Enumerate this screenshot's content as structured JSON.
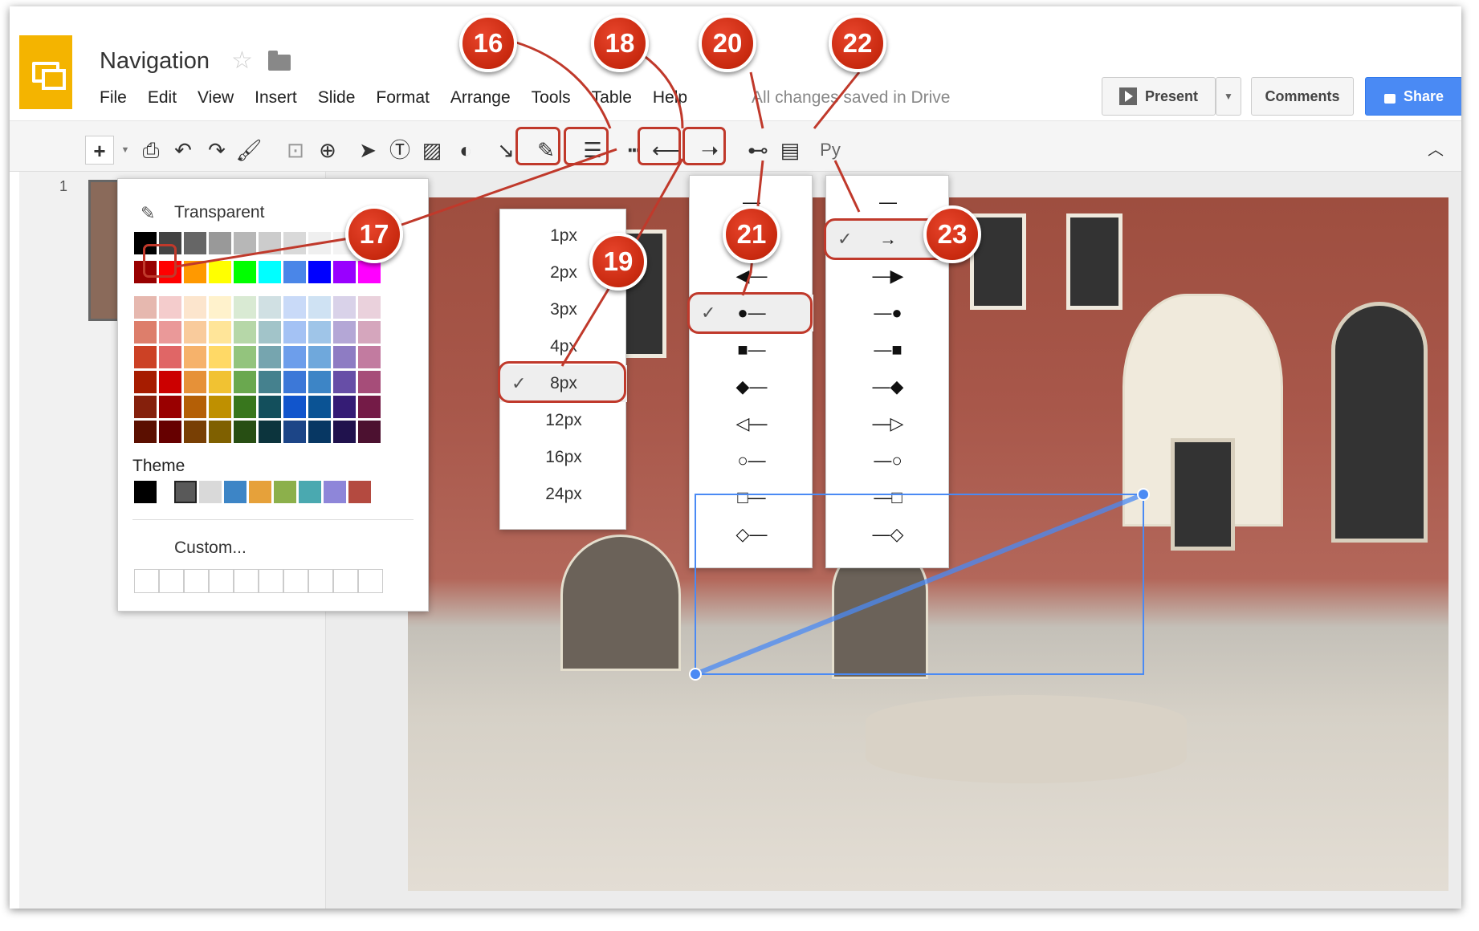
{
  "app": {
    "doc_title": "Navigation",
    "status": "All changes saved in Drive",
    "menu": [
      "File",
      "Edit",
      "View",
      "Insert",
      "Slide",
      "Format",
      "Arrange",
      "Tools",
      "Table",
      "Help"
    ],
    "present_label": "Present",
    "comments_label": "Comments",
    "share_label": "Share",
    "toolbar_py": "Py"
  },
  "filmstrip": {
    "slide_number": "1"
  },
  "color_panel": {
    "transparent_label": "Transparent",
    "theme_label": "Theme",
    "custom_label": "Custom...",
    "gray_row": [
      "#000000",
      "#434343",
      "#666666",
      "#999999",
      "#b7b7b7",
      "#cccccc",
      "#d9d9d9",
      "#efefef",
      "#f3f3f3",
      "#ffffff"
    ],
    "bright_row": [
      "#980000",
      "#ff0000",
      "#ff9900",
      "#ffff00",
      "#00ff00",
      "#00ffff",
      "#4a86e8",
      "#0000ff",
      "#9900ff",
      "#ff00ff"
    ],
    "shade_rows": [
      [
        "#e6b8af",
        "#f4cccc",
        "#fce5cd",
        "#fff2cc",
        "#d9ead3",
        "#d0e0e3",
        "#c9daf8",
        "#cfe2f3",
        "#d9d2e9",
        "#ead1dc"
      ],
      [
        "#dd7e6b",
        "#ea9999",
        "#f9cb9c",
        "#ffe599",
        "#b6d7a8",
        "#a2c4c9",
        "#a4c2f4",
        "#9fc5e8",
        "#b4a7d6",
        "#d5a6bd"
      ],
      [
        "#cc4125",
        "#e06666",
        "#f6b26b",
        "#ffd966",
        "#93c47d",
        "#76a5af",
        "#6d9eeb",
        "#6fa8dc",
        "#8e7cc3",
        "#c27ba0"
      ],
      [
        "#a61c00",
        "#cc0000",
        "#e69138",
        "#f1c232",
        "#6aa84f",
        "#45818e",
        "#3c78d8",
        "#3d85c6",
        "#674ea7",
        "#a64d79"
      ],
      [
        "#85200c",
        "#990000",
        "#b45f06",
        "#bf9000",
        "#38761d",
        "#134f5c",
        "#1155cc",
        "#0b5394",
        "#351c75",
        "#741b47"
      ],
      [
        "#5b0f00",
        "#660000",
        "#783f04",
        "#7f6000",
        "#274e13",
        "#0c343d",
        "#1c4587",
        "#073763",
        "#20124d",
        "#4c1130"
      ]
    ],
    "theme_row": [
      "#000000",
      "#ffffff",
      "#595959",
      "#d9d9d9",
      "#3d85c6",
      "#e6a13a",
      "#8cb04b",
      "#4aa9b0",
      "#8e86d9",
      "#b44a40"
    ],
    "selected_color": "#ff0000"
  },
  "weight_menu": {
    "options": [
      "1px",
      "2px",
      "3px",
      "4px",
      "8px",
      "12px",
      "16px",
      "24px"
    ],
    "selected": "8px"
  },
  "line_start_menu": {
    "options": [
      "none",
      "arrow",
      "filled-arrow",
      "filled-circle",
      "filled-square",
      "filled-diamond",
      "open-arrow",
      "open-circle",
      "open-square",
      "open-diamond"
    ],
    "selected": "filled-circle",
    "check": "✓"
  },
  "line_end_menu": {
    "options": [
      "none",
      "arrow",
      "filled-arrow",
      "filled-circle",
      "filled-square",
      "filled-diamond",
      "open-arrow",
      "open-circle",
      "open-square",
      "open-diamond"
    ],
    "selected": "arrow",
    "check": "✓"
  },
  "callouts": [
    "16",
    "17",
    "18",
    "19",
    "20",
    "21",
    "22",
    "23"
  ],
  "colors": {
    "callout_red": "#d0331a",
    "highlight": "#c0392b",
    "share_blue": "#4a8af4",
    "slides_yellow": "#f4b400",
    "selection_blue": "#1a73e8"
  }
}
